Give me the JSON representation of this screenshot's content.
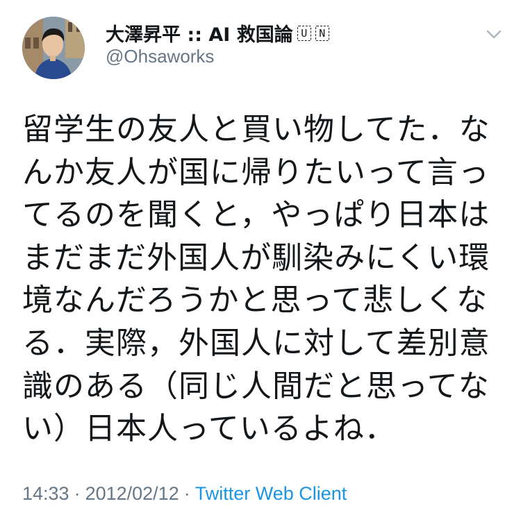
{
  "tweet": {
    "author": {
      "display_name": "大澤昇平 :: AI 救国論",
      "badges": [
        "U",
        "N"
      ],
      "handle": "@Ohsaworks"
    },
    "text_lines": [
      "留学生の友人と買い物してた．な",
      "んか友人が国に帰りたいって言っ",
      "てるのを聞くと，やっぱり日本は",
      "まだまだ外国人が馴染みにくい環",
      "境なんだろうかと思って悲しくな",
      "る．実際，外国人に対して差別意",
      "識のある（同じ人間だと思ってな",
      "い）日本人っているよね．"
    ],
    "meta": {
      "time": "14:33",
      "separator": "·",
      "date": "2012/02/12",
      "client": "Twitter Web Client"
    }
  },
  "icons": {
    "menu": "chevron-down-icon",
    "avatar": "profile-photo"
  },
  "colors": {
    "text": "#14171a",
    "secondary": "#657786",
    "link": "#1b95e0",
    "caret": "#aab8c2"
  }
}
